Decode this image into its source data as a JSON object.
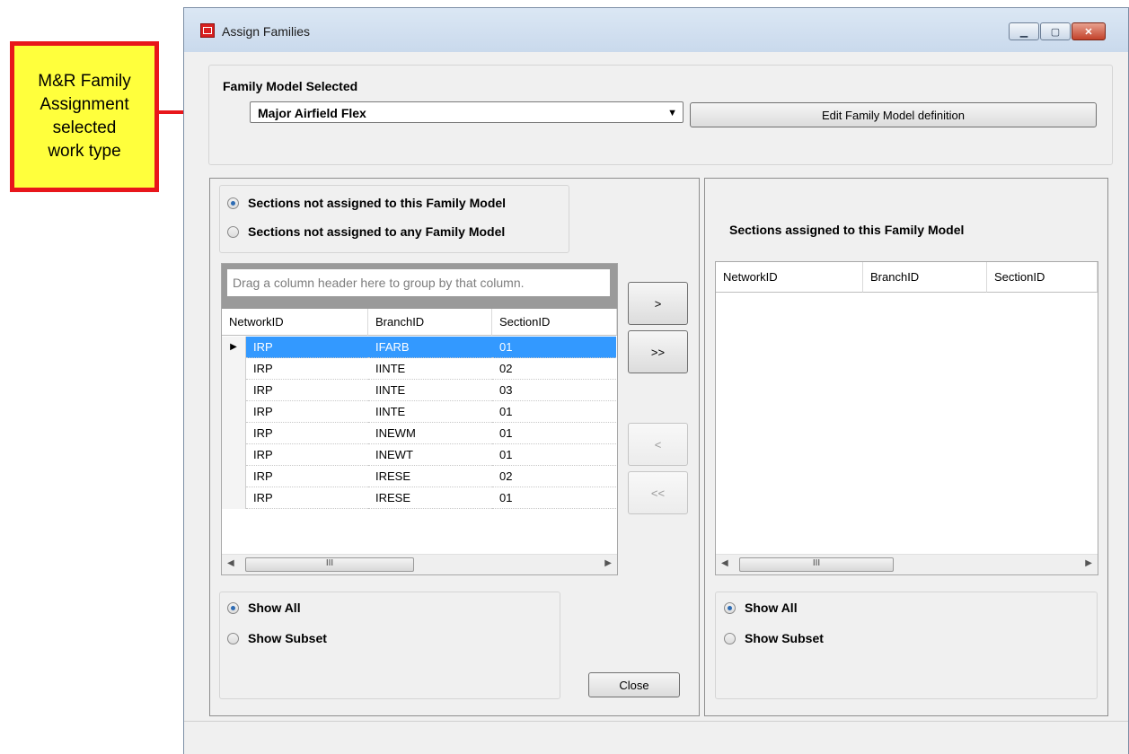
{
  "callout": {
    "text": "M&R Family\nAssignment\nselected\nwork type"
  },
  "window": {
    "title": "Assign Families",
    "controls": {
      "minimize": "▁",
      "maximize": "▢",
      "close": "✕"
    }
  },
  "family_model": {
    "label": "Family Model Selected",
    "selected": "Major Airfield Flex",
    "edit_button": "Edit Family Model definition"
  },
  "left": {
    "filter_options": [
      "Sections not assigned to this Family Model",
      "Sections not assigned to any Family Model"
    ],
    "group_hint": "Drag a column header here to group by that column.",
    "columns": [
      "NetworkID",
      "BranchID",
      "SectionID"
    ],
    "rows": [
      [
        "IRP",
        "IFARB",
        "01"
      ],
      [
        "IRP",
        "IINTE",
        "02"
      ],
      [
        "IRP",
        "IINTE",
        "03"
      ],
      [
        "IRP",
        "IINTE",
        "01"
      ],
      [
        "IRP",
        "INEWM",
        "01"
      ],
      [
        "IRP",
        "INEWT",
        "01"
      ],
      [
        "IRP",
        "IRESE",
        "02"
      ],
      [
        "IRP",
        "IRESE",
        "01"
      ]
    ],
    "show_options": [
      "Show All",
      "Show Subset"
    ],
    "close_button": "Close"
  },
  "transfer": {
    "add_one": ">",
    "add_all": ">>",
    "remove_one": "<",
    "remove_all": "<<"
  },
  "right": {
    "title": "Sections assigned to this Family Model",
    "columns": [
      "NetworkID",
      "BranchID",
      "SectionID"
    ],
    "show_options": [
      "Show All",
      "Show Subset"
    ]
  },
  "scrollbar": {
    "left_arrow": "◀",
    "right_arrow": "▶",
    "thumb_grip": "III"
  },
  "dropdown_caret": "▼",
  "row_pointer": "▶"
}
